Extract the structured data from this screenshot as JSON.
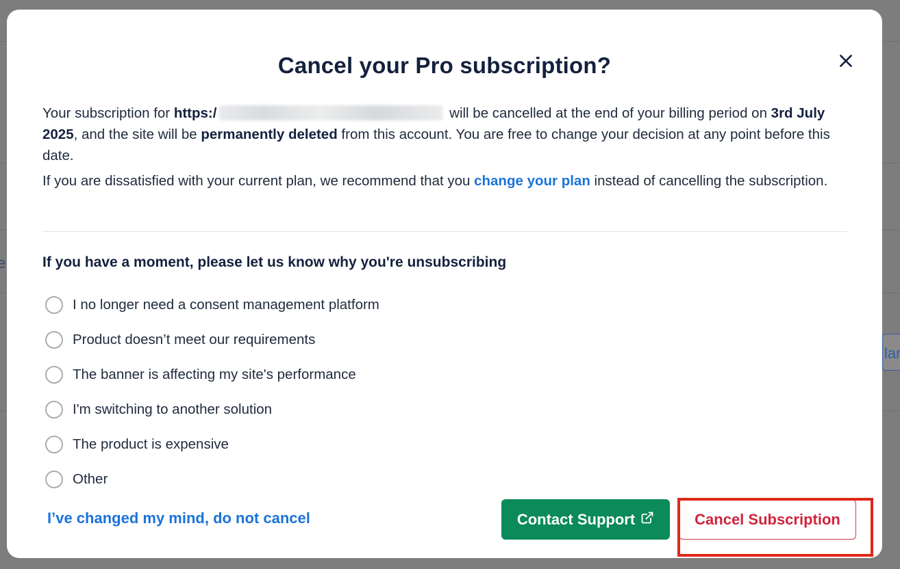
{
  "background": {
    "edge_text_left": "e",
    "edge_button_right": "lan"
  },
  "modal": {
    "title": "Cancel your Pro subscription?",
    "close_icon": "close-icon",
    "intro": {
      "text1": "Your subscription for ",
      "url_prefix": "https:/",
      "text2": " will be cancelled at the end of your billing period on ",
      "date": "3rd July 2025",
      "text3": ", and the site will be ",
      "deleted": "permanently deleted",
      "text4": " from this account. You are free to change your decision at any point before this date."
    },
    "recommend": {
      "text1": "If you are dissatisfied with your current plan, we recommend that you ",
      "link": "change your plan",
      "text2": " instead of cancelling the subscription."
    },
    "question": "If you have a moment, please let us know why you're unsubscribing",
    "options": [
      {
        "label": "I no longer need a consent management platform",
        "selected": false
      },
      {
        "label": "Product doesn’t meet our requirements",
        "selected": false
      },
      {
        "label": "The banner is affecting my site's performance",
        "selected": false
      },
      {
        "label": "I'm switching to another solution",
        "selected": false
      },
      {
        "label": "The product is expensive",
        "selected": false
      },
      {
        "label": "Other",
        "selected": false
      }
    ],
    "keep_link": "I’ve changed my mind, do not cancel",
    "contact_button": "Contact Support",
    "contact_icon": "external-link-icon",
    "cancel_button": "Cancel Subscription"
  },
  "colors": {
    "primary_link": "#1a73d9",
    "contact_green": "#0b8a5a",
    "cancel_red": "#d0243c",
    "highlight_red": "#e0261a"
  }
}
